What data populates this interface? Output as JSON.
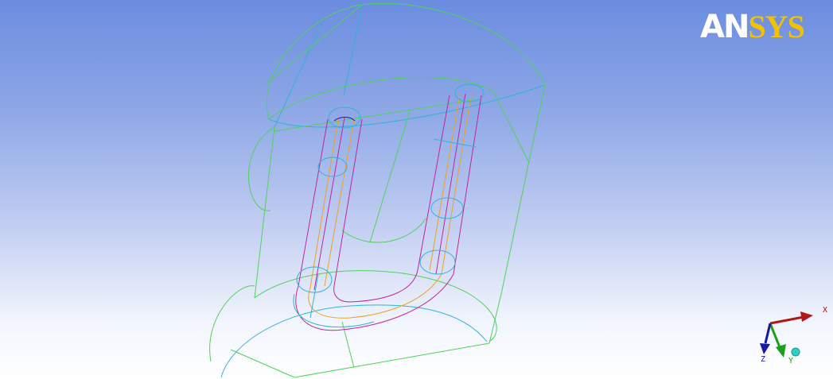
{
  "app": {
    "logo_part1": "AN",
    "logo_part2": "SYS"
  },
  "triad": {
    "x_label": "X",
    "y_label": "Y",
    "z_label": "Z"
  },
  "colors": {
    "background_top": "#6b8ce0",
    "background_bottom": "#ffffff",
    "logo_white": "#ffffff",
    "logo_gold": "#f2c200",
    "edge_green": "#4fd25a",
    "edge_cyan": "#2fb4d8",
    "edge_magenta": "#c0269c",
    "edge_orange": "#f0a020",
    "axis_x": "#b01818",
    "axis_y": "#18a018",
    "axis_z": "#1818a8",
    "axis_dot": "#30d0c8"
  }
}
